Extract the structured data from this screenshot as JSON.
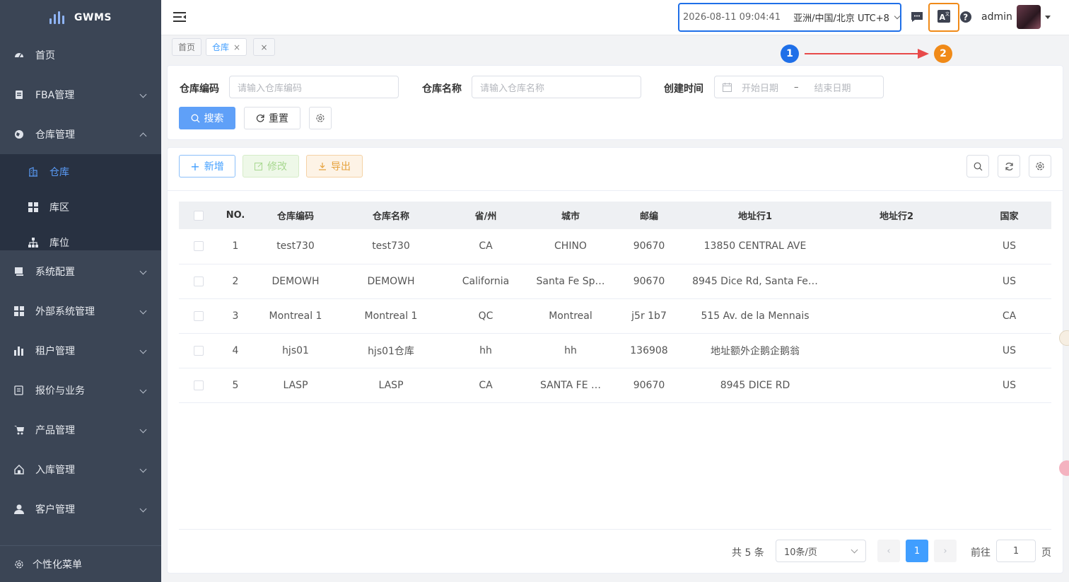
{
  "app": {
    "name": "GWMS"
  },
  "sidebar": {
    "items": [
      {
        "label": "首页",
        "icon": "dashboard-icon"
      },
      {
        "label": "FBA管理",
        "icon": "fba-icon"
      },
      {
        "label": "仓库管理",
        "icon": "globe-icon",
        "expanded": true
      },
      {
        "label": "系统配置",
        "icon": "monitor-icon"
      },
      {
        "label": "外部系统管理",
        "icon": "grid-icon"
      },
      {
        "label": "租户管理",
        "icon": "bar-chart-icon"
      },
      {
        "label": "报价与业务",
        "icon": "invoice-icon"
      },
      {
        "label": "产品管理",
        "icon": "cart-icon"
      },
      {
        "label": "入库管理",
        "icon": "home-icon"
      },
      {
        "label": "客户管理",
        "icon": "user-icon"
      }
    ],
    "sub_items": [
      {
        "label": "仓库",
        "icon": "building-icon",
        "active": true
      },
      {
        "label": "库区",
        "icon": "grid-icon"
      },
      {
        "label": "库位",
        "icon": "tree-icon"
      }
    ],
    "footer": "个性化菜单"
  },
  "topbar": {
    "datetime": "2026-08-11 09:04:41",
    "timezone": "亚洲/中国/北京 UTC+8",
    "user": "admin"
  },
  "tabs": [
    {
      "label": "首页",
      "active": false
    },
    {
      "label": "仓库",
      "active": true,
      "close": "×"
    }
  ],
  "tab_close_all": "×",
  "annotations": {
    "one": "1",
    "two": "2",
    "one_color": "#1f6fe8",
    "two_color": "#f08a18"
  },
  "search": {
    "code_label": "仓库编码",
    "code_placeholder": "请输入仓库编码",
    "name_label": "仓库名称",
    "name_placeholder": "请输入仓库名称",
    "time_label": "创建时间",
    "start_placeholder": "开始日期",
    "range_sep": "–",
    "end_placeholder": "结束日期",
    "search_btn": "搜索",
    "reset_btn": "重置"
  },
  "toolbar": {
    "add": "新增",
    "edit": "修改",
    "export": "导出"
  },
  "table": {
    "headers": [
      "NO.",
      "仓库编码",
      "仓库名称",
      "省/州",
      "城市",
      "邮编",
      "地址行1",
      "地址行2",
      "国家"
    ],
    "rows": [
      [
        "1",
        "test730",
        "test730",
        "CA",
        "CHINO",
        "90670",
        "13850 CENTRAL AVE",
        "",
        "US"
      ],
      [
        "2",
        "DEMOWH",
        "DEMOWH",
        "California",
        "Santa Fe Sp…",
        "90670",
        "8945 Dice Rd, Santa Fe…",
        "",
        "US"
      ],
      [
        "3",
        "Montreal 1",
        "Montreal 1",
        "QC",
        "Montreal",
        "j5r 1b7",
        "515 Av. de la Mennais",
        "",
        "CA"
      ],
      [
        "4",
        "hjs01",
        "hjs01仓库",
        "hh",
        "hh",
        "136908",
        "地址额外企鹅企鹅翁",
        "",
        "US"
      ],
      [
        "5",
        "LASP",
        "LASP",
        "CA",
        "SANTA FE …",
        "90670",
        "8945 DICE RD",
        "",
        "US"
      ]
    ]
  },
  "pagination": {
    "total": "共 5 条",
    "page_size": "10条/页",
    "current": "1",
    "goto_label": "前往",
    "goto_value": "1",
    "page_suffix": "页"
  },
  "colors": {
    "primary": "#409eff",
    "sidebar": "#3b4555",
    "submenu": "#283141"
  }
}
